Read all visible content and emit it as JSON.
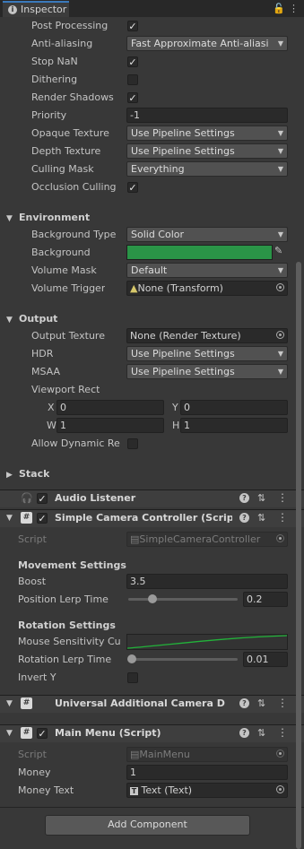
{
  "window": {
    "tab_title": "Inspector",
    "lock_icon": "lock-icon",
    "menu_icon": "kebab-menu-icon"
  },
  "camera": {
    "rows": [
      {
        "label": "Post Processing",
        "checked": true
      },
      {
        "label": "Anti-aliasing",
        "value": "Fast Approximate Anti-aliasi"
      },
      {
        "label": "Stop NaN",
        "checked": true
      },
      {
        "label": "Dithering",
        "checked": false
      },
      {
        "label": "Render Shadows",
        "checked": true
      },
      {
        "label": "Priority",
        "value": "-1"
      },
      {
        "label": "Opaque Texture",
        "value": "Use Pipeline Settings"
      },
      {
        "label": "Depth Texture",
        "value": "Use Pipeline Settings"
      },
      {
        "label": "Culling Mask",
        "value": "Everything"
      },
      {
        "label": "Occlusion Culling",
        "checked": true
      }
    ],
    "environment": {
      "title": "Environment",
      "background_type_label": "Background Type",
      "background_type": "Solid Color",
      "background_label": "Background",
      "background_color": "#2a9447",
      "volume_mask_label": "Volume Mask",
      "volume_mask": "Default",
      "volume_trigger_label": "Volume Trigger",
      "volume_trigger": "None (Transform)"
    },
    "output": {
      "title": "Output",
      "output_texture_label": "Output Texture",
      "output_texture": "None (Render Texture)",
      "hdr_label": "HDR",
      "hdr": "Use Pipeline Settings",
      "msaa_label": "MSAA",
      "msaa": "Use Pipeline Settings",
      "viewport_label": "Viewport Rect",
      "x_label": "X",
      "x": "0",
      "y_label": "Y",
      "y": "0",
      "w_label": "W",
      "w": "1",
      "h_label": "H",
      "h": "1",
      "allow_dynamic_label": "Allow Dynamic Re"
    },
    "stack": {
      "title": "Stack"
    }
  },
  "components": {
    "audio_listener": {
      "title": "Audio Listener"
    },
    "simple_camera": {
      "title": "Simple Camera Controller (Script)",
      "script_label": "Script",
      "script_value": "SimpleCameraController",
      "movement_header": "Movement Settings",
      "boost_label": "Boost",
      "boost": "3.5",
      "position_lerp_label": "Position Lerp Time",
      "position_lerp": "0.2",
      "rotation_header": "Rotation Settings",
      "mouse_sens_label": "Mouse Sensitivity Cu",
      "rotation_lerp_label": "Rotation Lerp Time",
      "rotation_lerp": "0.01",
      "invert_y_label": "Invert Y"
    },
    "urp_camera": {
      "title": "Universal Additional Camera D"
    },
    "main_menu": {
      "title": "Main Menu (Script)",
      "script_label": "Script",
      "script_value": "MainMenu",
      "money_label": "Money",
      "money": "1",
      "money_text_label": "Money Text",
      "money_text": "Text (Text)"
    }
  },
  "add_component_label": "Add Component",
  "colors": {
    "accent": "#3a79bb",
    "curve": "#22b33a"
  }
}
